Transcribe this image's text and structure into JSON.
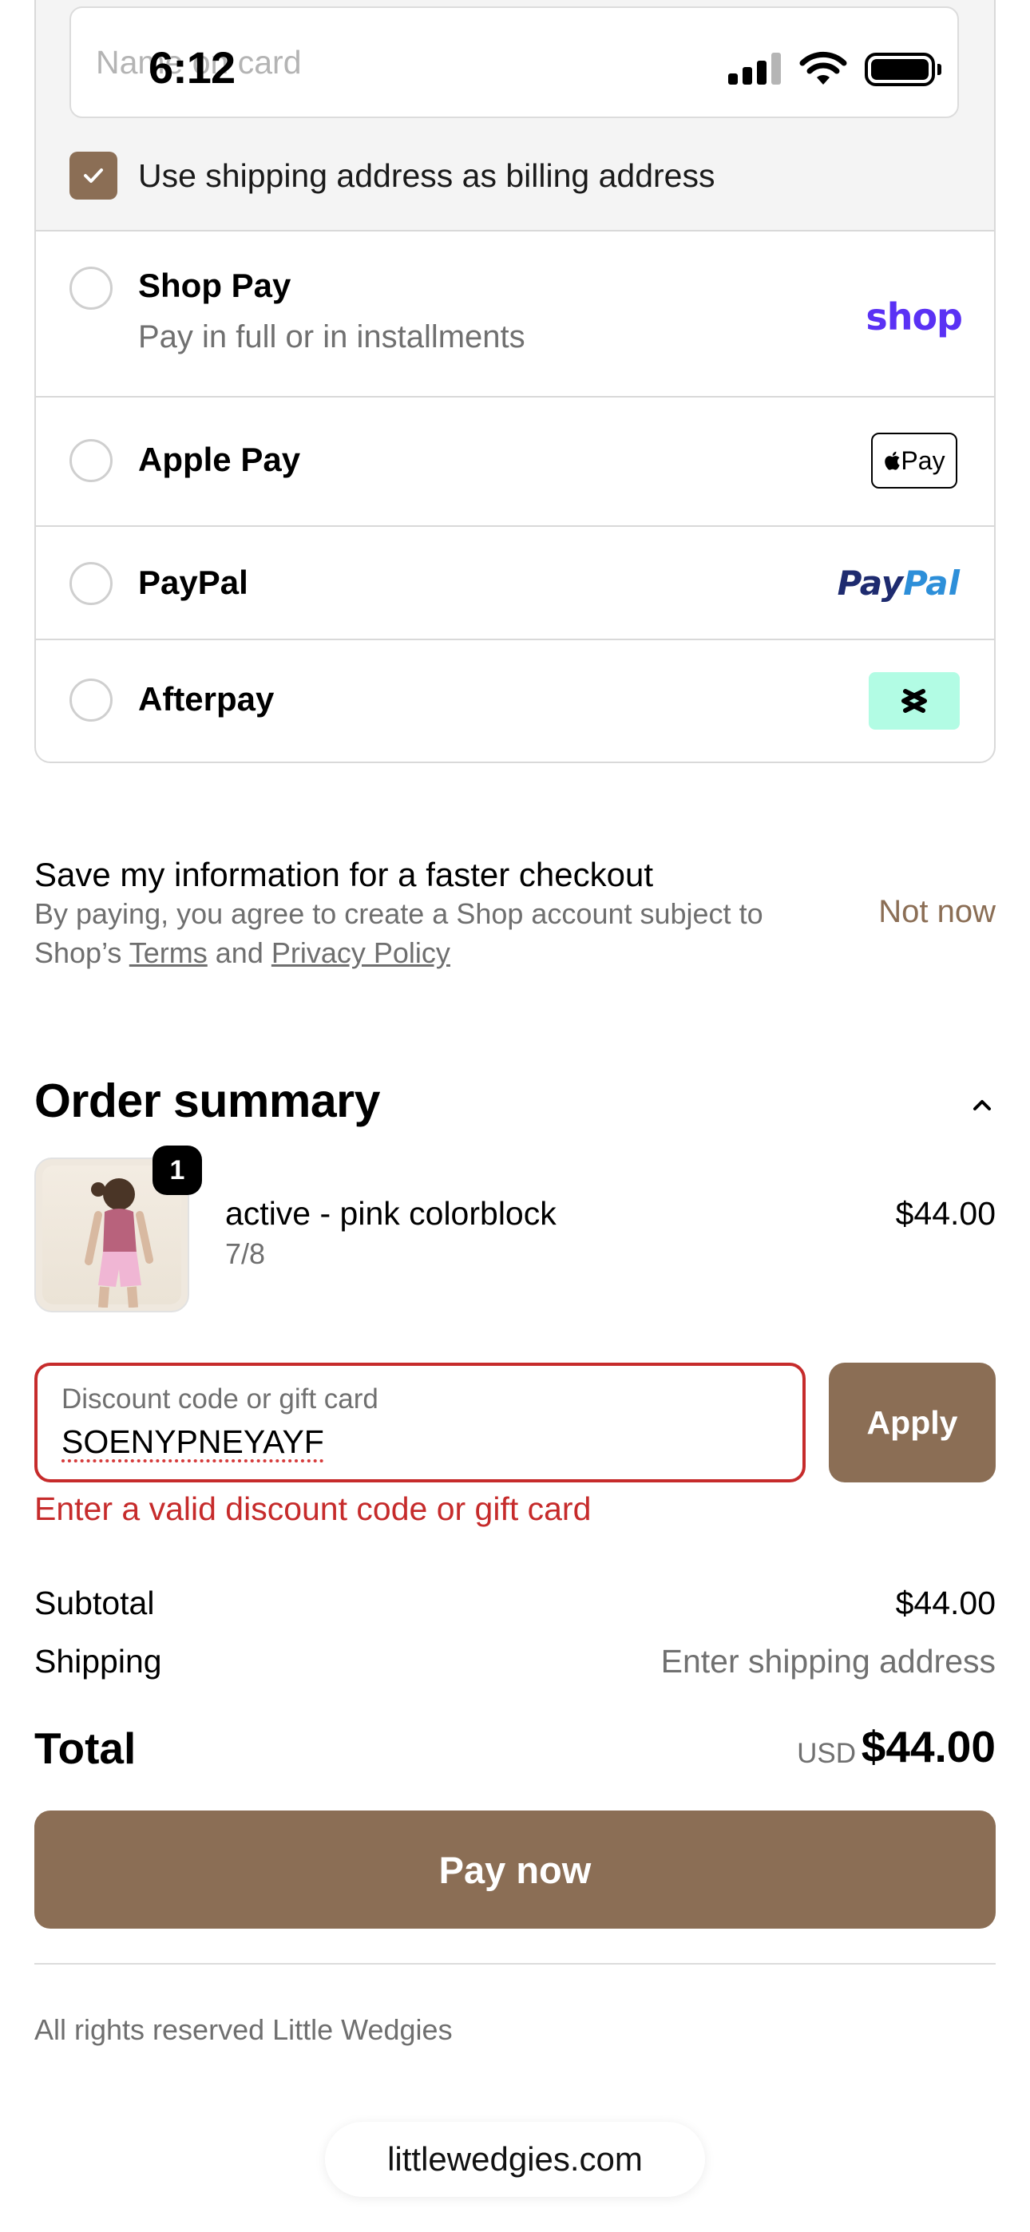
{
  "status_bar": {
    "time": "6:12"
  },
  "card_form": {
    "name_placeholder": "Name on card"
  },
  "billing": {
    "label": "Use shipping address as billing address",
    "checked": true
  },
  "payment_methods": [
    {
      "name": "Shop Pay",
      "subtitle": "Pay in full or in installments",
      "logo_text": "shop"
    },
    {
      "name": "Apple Pay",
      "logo_text": "Pay"
    },
    {
      "name": "PayPal",
      "logo_text_1": "Pay",
      "logo_text_2": "Pal"
    },
    {
      "name": "Afterpay"
    }
  ],
  "save_info": {
    "title": "Save my information for a faster checkout",
    "desc_prefix": "By paying, you agree to create a Shop account subject to Shop’s ",
    "terms_link": "Terms",
    "desc_and": " and ",
    "privacy_link": "Privacy Policy",
    "not_now": "Not now"
  },
  "order_summary": {
    "title": "Order summary",
    "item": {
      "quantity": "1",
      "name": "active - pink colorblock",
      "variant": "7/8",
      "price": "$44.00"
    },
    "discount": {
      "label": "Discount code or gift card",
      "value": "SOENYPNEYAYF",
      "apply": "Apply",
      "error": "Enter a valid discount code or gift card"
    },
    "subtotal_label": "Subtotal",
    "subtotal_value": "$44.00",
    "shipping_label": "Shipping",
    "shipping_value": "Enter shipping address",
    "total_label": "Total",
    "total_currency": "USD",
    "total_value": "$44.00"
  },
  "pay_now": "Pay now",
  "footer": {
    "rights": "All rights reserved Little Wedgies"
  },
  "browser": {
    "url": "littlewedgies.com"
  },
  "colors": {
    "accent": "#8b6e55",
    "error": "#c62b2b",
    "shop_purple": "#5a31f4"
  }
}
